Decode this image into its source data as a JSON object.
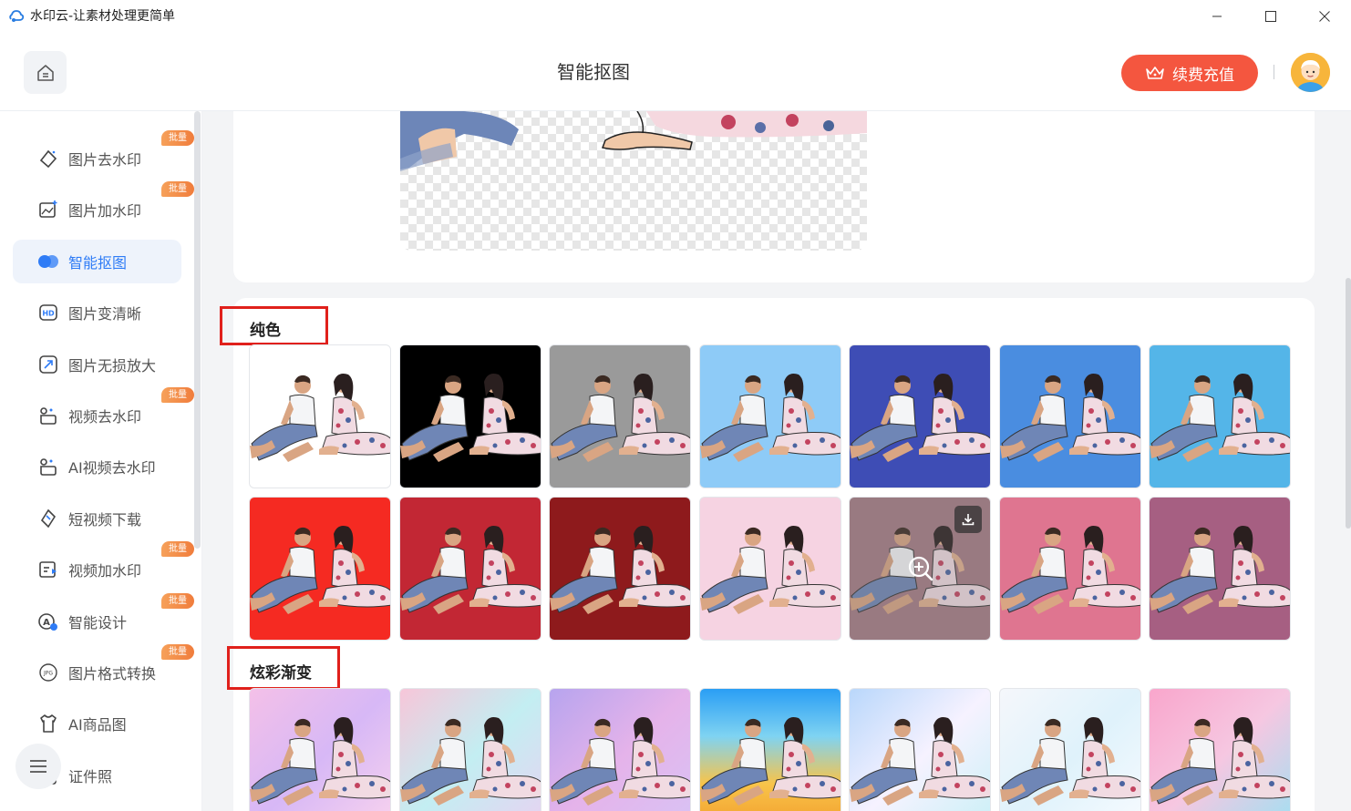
{
  "window": {
    "title": "水印云-让素材处理更简单"
  },
  "header": {
    "title": "智能抠图",
    "renew_label": "续费充值"
  },
  "sidebar": {
    "items": [
      {
        "label": "图片去水印",
        "badge": "批量",
        "icon": "eraser-icon"
      },
      {
        "label": "图片加水印",
        "badge": "批量",
        "icon": "image-add-icon"
      },
      {
        "label": "智能抠图",
        "badge": "",
        "icon": "cutout-icon",
        "active": true
      },
      {
        "label": "图片变清晰",
        "badge": "",
        "icon": "hd-icon"
      },
      {
        "label": "图片无损放大",
        "badge": "",
        "icon": "enlarge-icon"
      },
      {
        "label": "视频去水印",
        "badge": "批量",
        "icon": "video-clean-icon"
      },
      {
        "label": "AI视频去水印",
        "badge": "",
        "icon": "ai-video-icon"
      },
      {
        "label": "短视频下载",
        "badge": "",
        "icon": "download-video-icon"
      },
      {
        "label": "视频加水印",
        "badge": "批量",
        "icon": "video-add-icon"
      },
      {
        "label": "智能设计",
        "badge": "批量",
        "icon": "design-icon"
      },
      {
        "label": "图片格式转换",
        "badge": "批量",
        "icon": "jpg-icon"
      },
      {
        "label": "AI商品图",
        "badge": "",
        "icon": "shirt-icon"
      },
      {
        "label": "证件照",
        "badge": "",
        "icon": "id-photo-icon"
      }
    ]
  },
  "sections": {
    "solid": {
      "label": "纯色",
      "colors": [
        "#ffffff",
        "#000000",
        "#9a9a9a",
        "#8ecbf7",
        "#3e4db5",
        "#4a8de0",
        "#54b5e8",
        "#f52a22",
        "#c22734",
        "#8e1a1c",
        "#f6d3e2",
        "#a47b85",
        "#df7590",
        "#a65f82"
      ]
    },
    "gradient": {
      "label": "炫彩渐变",
      "gradients": [
        "linear-gradient(135deg,#f4c0e8,#d7b8f6,#f9d3ee)",
        "linear-gradient(135deg,#f7c6d9,#c3eef2,#e8d2f2)",
        "linear-gradient(135deg,#b7a4ee,#e5b3ea,#d8c3f5)",
        "linear-gradient(180deg,#2a9ef4,#7fd3f2,#f8c44a,#f29b2a)",
        "linear-gradient(135deg,#b9d7fb,#f6f2ff,#c9f0f6)",
        "linear-gradient(135deg,#f5f7fb,#dff2fb,#f7fbff)",
        "linear-gradient(135deg,#f9a6cc,#f6c7e1,#9fe0f2)"
      ]
    }
  },
  "hovered_tile": {
    "section": "solid",
    "index": 11,
    "download_icon": "download-icon",
    "zoom_icon": "zoom-in-icon"
  }
}
